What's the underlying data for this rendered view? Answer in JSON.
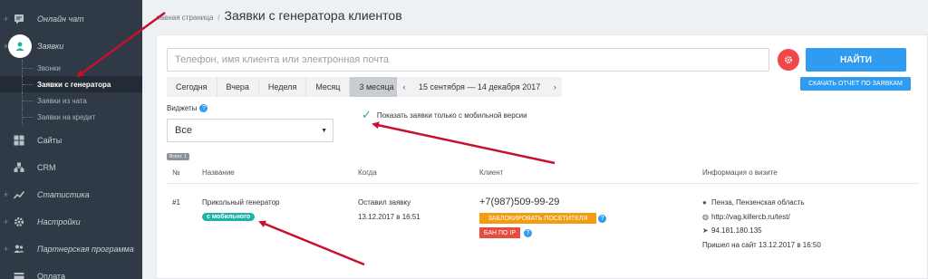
{
  "sidebar": {
    "items": [
      {
        "label": "Онлайн чат",
        "icon": "chat-icon",
        "plus": "+"
      },
      {
        "label": "Заявки",
        "icon": "user-icon",
        "plus": "×"
      },
      {
        "label": "Сайты",
        "icon": "sites-icon"
      },
      {
        "label": "CRM",
        "icon": "crm-icon"
      },
      {
        "label": "Статистика",
        "icon": "chart-icon",
        "plus": "+"
      },
      {
        "label": "Настройки",
        "icon": "gear-icon",
        "plus": "+"
      },
      {
        "label": "Партнерская программа",
        "icon": "partners-icon",
        "plus": "+"
      },
      {
        "label": "Оплата",
        "icon": "card-icon"
      }
    ],
    "subitems": [
      "Звонки",
      "Заявки с генератора",
      "Заявки из чата",
      "Заявки на кредит"
    ]
  },
  "header": {
    "breadcrumb_home": "лавная страница",
    "breadcrumb_sep": "/",
    "title": "Заявки с генератора клиентов"
  },
  "filters": {
    "search_placeholder": "Телефон, имя клиента или электронная почта",
    "find_label": "НАЙТИ",
    "report_label": "СКАЧАТЬ ОТЧЕТ ПО ЗАЯВКАМ",
    "periods": [
      "Сегодня",
      "Вчера",
      "Неделя",
      "Месяц",
      "3 месяца"
    ],
    "active_period": "3 месяца",
    "date_prev": "‹",
    "date_range": "15 сентября — 14 декабря 2017",
    "date_next": "›",
    "widgets_label": "Виджеты",
    "widget_selected": "Все",
    "mobile_only_label": "Показать заявки только с мобильной версии",
    "mobile_only_checked": true
  },
  "table": {
    "total": "Всего: 1",
    "headers": [
      "№",
      "Название",
      "Когда",
      "Клиент",
      "Информация о визите"
    ],
    "rows": [
      {
        "num": "#1",
        "name": "Прикольный генератор",
        "badge": "с мобильного",
        "when_label": "Оставил заявку",
        "when_date": "13.12.2017 в 16:51",
        "phone": "+7(987)509-99-29",
        "block_label": "ЗАБЛОКИРОВАТЬ ПОСЕТИТЕЛЯ",
        "ban_label": "БАН ПО IP",
        "location": "Пенза, Пензенская область",
        "url": "http://vag.killercb.ru/test/",
        "ip": "94.181.180.135",
        "visit": "Пришел на сайт 13.12.2017 в 16:50"
      }
    ]
  },
  "help_glyph": "?",
  "colors": {
    "sidebar": "#2f3a46",
    "primary": "#2f9cf1",
    "danger": "#f0474a",
    "teal": "#1bb3a6",
    "orange": "#f39c12",
    "red": "#e74c3c",
    "annotation": "#c8102e"
  }
}
